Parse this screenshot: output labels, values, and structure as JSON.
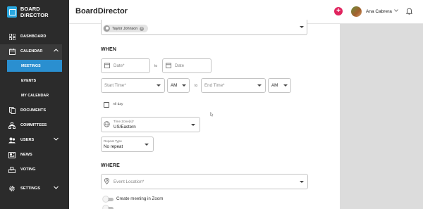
{
  "brand": {
    "name": "BOARD DIRECTOR"
  },
  "sidebar": {
    "items": [
      {
        "label": "DASHBOARD",
        "icon": "grid-icon"
      },
      {
        "label": "CALENDAR",
        "icon": "calendar-icon"
      },
      {
        "label": "DOCUMENTS",
        "icon": "documents-icon"
      },
      {
        "label": "COMMITTEES",
        "icon": "committees-icon"
      },
      {
        "label": "USERS",
        "icon": "users-icon"
      },
      {
        "label": "NEWS",
        "icon": "news-icon"
      },
      {
        "label": "VOTING",
        "icon": "voting-icon"
      },
      {
        "label": "SETTINGS",
        "icon": "gear-icon"
      }
    ],
    "calendar_sub": [
      {
        "label": "MEETINGS",
        "active": true
      },
      {
        "label": "EVENTS",
        "active": false
      },
      {
        "label": "MY CALENDAR",
        "active": false
      }
    ]
  },
  "header": {
    "title": "BoardDirector",
    "user_name": "Ana Cabrera"
  },
  "form": {
    "attendee_chip": "Taylor Johnson",
    "when_heading": "WHEN",
    "start_date_placeholder": "Date*",
    "end_date_placeholder": "Date",
    "to_label": "to",
    "start_time_placeholder": "Start Time*",
    "end_time_placeholder": "End Time*",
    "start_ampm": "AM",
    "end_ampm": "AM",
    "all_day_label": "All day",
    "timezone_label": "Time Zone(s)*",
    "timezone_value": "US/Eastern",
    "repeat_label": "Repeat Type",
    "repeat_value": "No repeat",
    "where_heading": "WHERE",
    "location_placeholder": "Event Location*",
    "zoom_label": "Create meeting in Zoom"
  },
  "colors": {
    "sidebar_bg": "#2b2b2b",
    "accent_blue": "#2a8fd0",
    "brand_blue": "#2aa8e0",
    "add_button": "#e0245e"
  }
}
